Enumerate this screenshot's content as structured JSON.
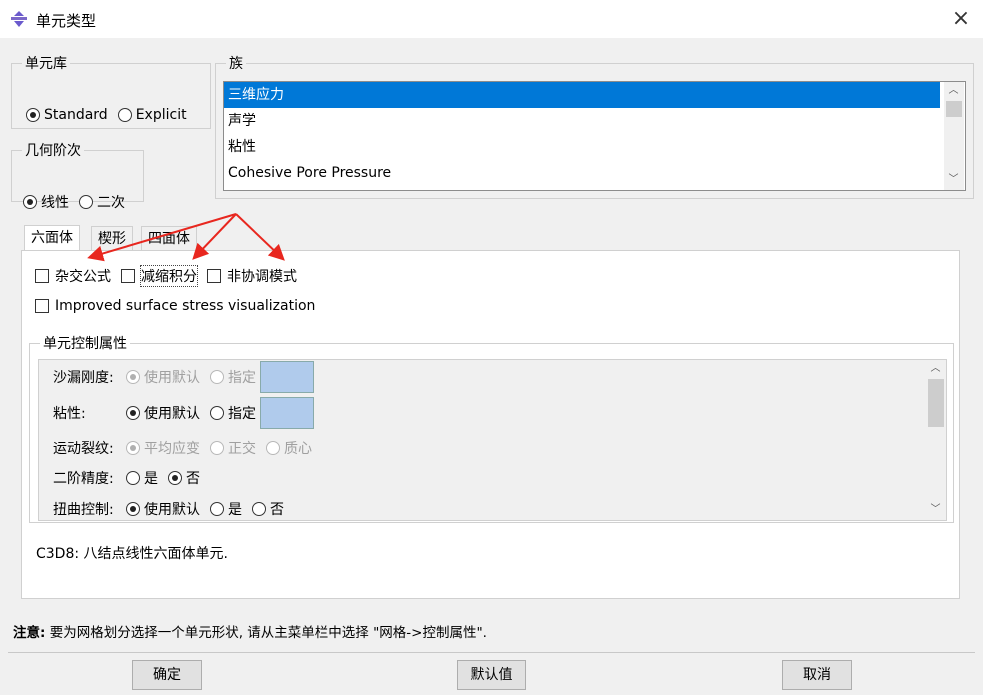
{
  "window": {
    "title": "单元类型",
    "icon": "app-icon",
    "close_icon": "close-icon"
  },
  "element_library": {
    "legend": "单元库",
    "options": [
      "Standard",
      "Explicit"
    ],
    "selected": "Standard"
  },
  "geometric_order": {
    "legend": "几何阶次",
    "options": [
      "线性",
      "二次"
    ],
    "selected": "线性"
  },
  "family": {
    "legend": "族",
    "items": [
      "三维应力",
      "声学",
      "粘性",
      "Cohesive Pore Pressure"
    ],
    "selected": "三维应力"
  },
  "tabs": [
    "六面体",
    "楔形",
    "四面体"
  ],
  "active_tab": "六面体",
  "checkboxes": {
    "hybrid": "杂交公式",
    "reduced": "减缩积分",
    "incompatible": "非协调模式",
    "improved": "Improved surface stress visualization"
  },
  "controls": {
    "legend": "单元控制属性",
    "hourglass": {
      "label": "沙漏刚度:",
      "opt1": "使用默认",
      "opt2": "指定"
    },
    "viscosity": {
      "label": "粘性:",
      "opt1": "使用默认",
      "opt2": "指定"
    },
    "kinematic": {
      "label": "运动裂纹:",
      "opt1": "平均应变",
      "opt2": "正交",
      "opt3": "质心"
    },
    "second_order": {
      "label": "二阶精度:",
      "opt1": "是",
      "opt2": "否"
    },
    "distortion": {
      "label": "扭曲控制:",
      "opt1": "使用默认",
      "opt2": "是",
      "opt3": "否"
    }
  },
  "description": "C3D8:  八结点线性六面体单元.",
  "note": {
    "label": "注意:",
    "text": " 要为网格划分选择一个单元形状, 请从主菜单栏中选择 \"网格->控制属性\"."
  },
  "buttons": {
    "ok": "确定",
    "defaults": "默认值",
    "cancel": "取消"
  },
  "colors": {
    "selection": "#0078d7",
    "annotation_arrow": "#e8271f",
    "swatch": "#b0cbec"
  }
}
